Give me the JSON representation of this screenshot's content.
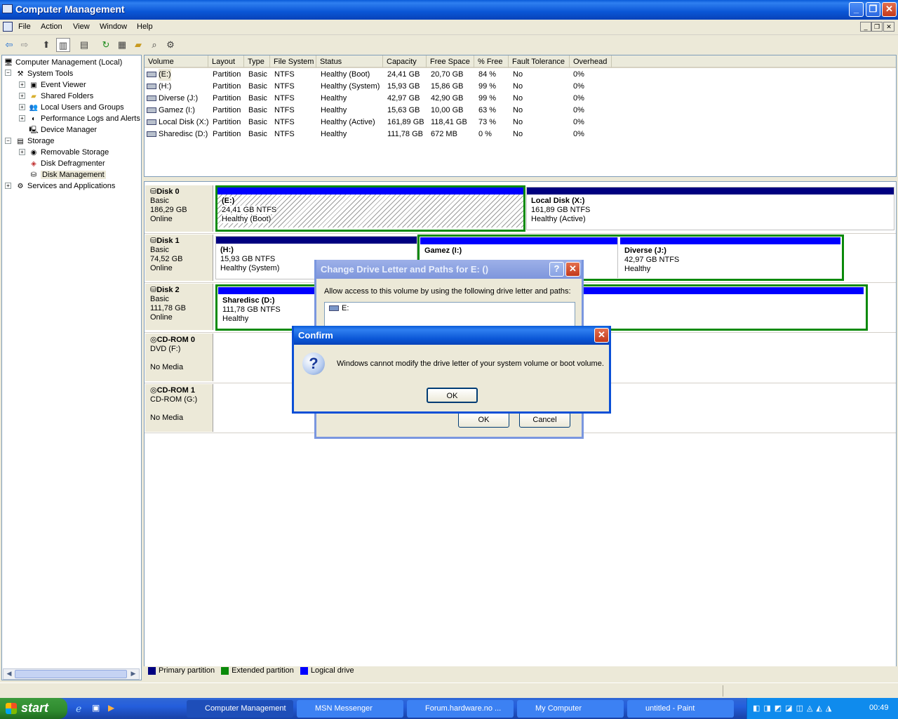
{
  "window": {
    "title": "Computer Management"
  },
  "menu": [
    "File",
    "Action",
    "View",
    "Window",
    "Help"
  ],
  "tree": {
    "root": "Computer Management (Local)",
    "system_tools": "System Tools",
    "event_viewer": "Event Viewer",
    "shared_folders": "Shared Folders",
    "local_users": "Local Users and Groups",
    "perf_logs": "Performance Logs and Alerts",
    "device_manager": "Device Manager",
    "storage": "Storage",
    "removable_storage": "Removable Storage",
    "disk_defrag": "Disk Defragmenter",
    "disk_mgmt": "Disk Management",
    "services": "Services and Applications"
  },
  "volumes": {
    "headers": [
      "Volume",
      "Layout",
      "Type",
      "File System",
      "Status",
      "Capacity",
      "Free Space",
      "% Free",
      "Fault Tolerance",
      "Overhead"
    ],
    "rows": [
      [
        "(E:)",
        "Partition",
        "Basic",
        "NTFS",
        "Healthy (Boot)",
        "24,41 GB",
        "20,70 GB",
        "84 %",
        "No",
        "0%"
      ],
      [
        "(H:)",
        "Partition",
        "Basic",
        "NTFS",
        "Healthy (System)",
        "15,93 GB",
        "15,86 GB",
        "99 %",
        "No",
        "0%"
      ],
      [
        "Diverse (J:)",
        "Partition",
        "Basic",
        "NTFS",
        "Healthy",
        "42,97 GB",
        "42,90 GB",
        "99 %",
        "No",
        "0%"
      ],
      [
        "Gamez (I:)",
        "Partition",
        "Basic",
        "NTFS",
        "Healthy",
        "15,63 GB",
        "10,00 GB",
        "63 %",
        "No",
        "0%"
      ],
      [
        "Local Disk (X:)",
        "Partition",
        "Basic",
        "NTFS",
        "Healthy (Active)",
        "161,89 GB",
        "118,41 GB",
        "73 %",
        "No",
        "0%"
      ],
      [
        "Sharedisc (D:)",
        "Partition",
        "Basic",
        "NTFS",
        "Healthy",
        "111,78 GB",
        "672 MB",
        "0 %",
        "No",
        "0%"
      ]
    ]
  },
  "disks": {
    "d0": {
      "name": "Disk 0",
      "type": "Basic",
      "size": "186,29 GB",
      "state": "Online"
    },
    "d1": {
      "name": "Disk 1",
      "type": "Basic",
      "size": "74,52 GB",
      "state": "Online"
    },
    "d2": {
      "name": "Disk 2",
      "type": "Basic",
      "size": "111,78 GB",
      "state": "Online"
    },
    "cd0": {
      "name": "CD-ROM 0",
      "type": "DVD (F:)",
      "state": "No Media"
    },
    "cd1": {
      "name": "CD-ROM 1",
      "type": "CD-ROM (G:)",
      "state": "No Media"
    }
  },
  "partitions": {
    "e": {
      "name": "(E:)",
      "size": "24,41 GB NTFS",
      "status": "Healthy (Boot)"
    },
    "x": {
      "name": "Local Disk  (X:)",
      "size": "161,89 GB NTFS",
      "status": "Healthy (Active)"
    },
    "h": {
      "name": "(H:)",
      "size": "15,93 GB NTFS",
      "status": "Healthy (System)"
    },
    "i": {
      "name": "Gamez  (I:)"
    },
    "j": {
      "name": "Diverse  (J:)",
      "size": "42,97 GB NTFS",
      "status": "Healthy"
    },
    "d": {
      "name": "Sharedisc  (D:)",
      "size": "111,78 GB NTFS",
      "status": "Healthy"
    }
  },
  "legend": {
    "primary": "Primary partition",
    "extended": "Extended partition",
    "logical": "Logical drive"
  },
  "change_dialog": {
    "title": "Change Drive Letter and Paths for E: ()",
    "text": "Allow access to this volume by using the following drive letter and paths:",
    "item": "E:",
    "ok": "OK",
    "cancel": "Cancel"
  },
  "confirm_dialog": {
    "title": "Confirm",
    "message": "Windows cannot modify the drive letter of your system volume or boot volume.",
    "ok": "OK"
  },
  "taskbar": {
    "start": "start",
    "items": [
      "Computer Management",
      "MSN Messenger",
      "Forum.hardware.no ...",
      "My Computer",
      "untitled - Paint"
    ],
    "clock": "00:49"
  },
  "colors": {
    "titlebar": "#0a56d6",
    "primary": "#000080",
    "logical": "#0000ff",
    "extended": "#0a8a0a"
  }
}
